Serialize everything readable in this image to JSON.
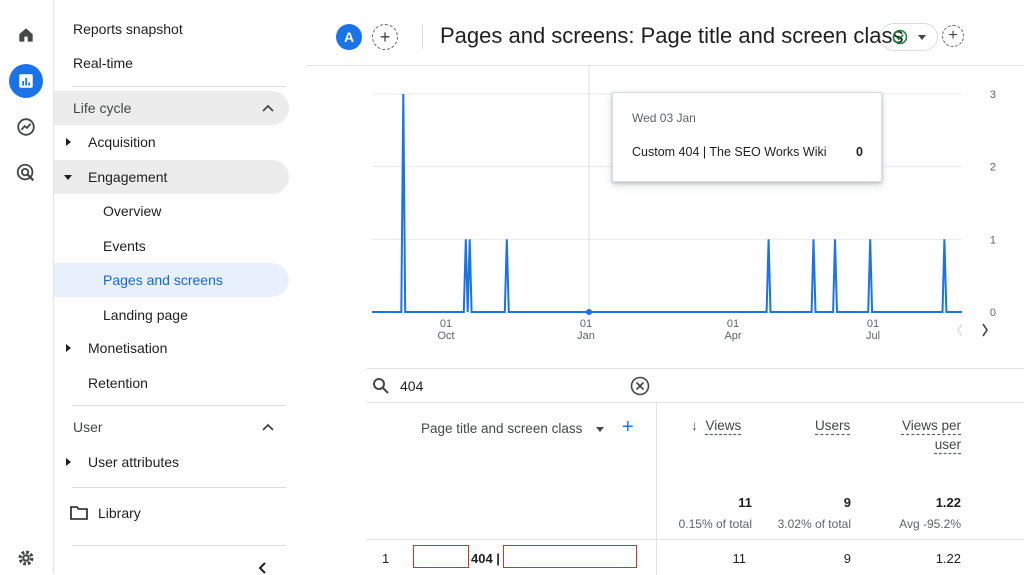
{
  "rail": {
    "icons": [
      "home-icon",
      "reports-icon",
      "explore-icon",
      "advertising-icon",
      "settings-icon"
    ]
  },
  "nav": {
    "reports_snapshot": "Reports snapshot",
    "realtime": "Real-time",
    "lifecycle": "Life cycle",
    "acquisition": "Acquisition",
    "engagement": "Engagement",
    "overview": "Overview",
    "events": "Events",
    "pages_and_screens": "Pages and screens",
    "landing_page": "Landing page",
    "monetisation": "Monetisation",
    "retention": "Retention",
    "user": "User",
    "user_attributes": "User attributes",
    "library": "Library"
  },
  "header": {
    "avatar_letter": "A",
    "title": "Pages and screens: Page title and screen class"
  },
  "chart_data": {
    "type": "line",
    "x_tick_labels": [
      {
        "day": "01",
        "month": "Oct"
      },
      {
        "day": "01",
        "month": "Jan"
      },
      {
        "day": "01",
        "month": "Apr"
      },
      {
        "day": "01",
        "month": "Jul"
      }
    ],
    "y_ticks": [
      0,
      1,
      2,
      3
    ],
    "ylim": [
      0,
      3
    ],
    "series_values": [
      0,
      0,
      0,
      0,
      0,
      0,
      0,
      0,
      0,
      0,
      0,
      0,
      0,
      0,
      0,
      0,
      3,
      0,
      0,
      0,
      0,
      0,
      0,
      0,
      0,
      0,
      0,
      0,
      0,
      0,
      0,
      0,
      0,
      0,
      0,
      0,
      0,
      0,
      0,
      0,
      0,
      0,
      0,
      0,
      0,
      0,
      0,
      0,
      1,
      0,
      1,
      0,
      0,
      0,
      0,
      0,
      0,
      0,
      0,
      0,
      0,
      0,
      0,
      0,
      0,
      0,
      0,
      0,
      0,
      1,
      0,
      0,
      0,
      0,
      0,
      0,
      0,
      0,
      0,
      0,
      0,
      0,
      0,
      0,
      0,
      0,
      0,
      0,
      0,
      0,
      0,
      0,
      0,
      0,
      0,
      0,
      0,
      0,
      0,
      0,
      0,
      0,
      0,
      0,
      0,
      0,
      0,
      0,
      0,
      0,
      0,
      0,
      0,
      0,
      0,
      0,
      0,
      0,
      0,
      0,
      0,
      0,
      0,
      0,
      0,
      0,
      0,
      0,
      0,
      0,
      0,
      0,
      0,
      0,
      0,
      0,
      0,
      0,
      0,
      0,
      0,
      0,
      0,
      0,
      0,
      0,
      0,
      0,
      0,
      0,
      0,
      0,
      0,
      0,
      0,
      0,
      0,
      0,
      0,
      0,
      0,
      0,
      0,
      0,
      0,
      0,
      0,
      0,
      0,
      0,
      0,
      0,
      0,
      0,
      0,
      0,
      0,
      0,
      0,
      0,
      0,
      0,
      0,
      0,
      0,
      0,
      0,
      0,
      0,
      0,
      0,
      0,
      0,
      0,
      0,
      0,
      0,
      0,
      0,
      0,
      0,
      0,
      0,
      1,
      0,
      0,
      0,
      0,
      0,
      0,
      0,
      0,
      0,
      0,
      0,
      0,
      0,
      0,
      0,
      0,
      0,
      0,
      0,
      0,
      0,
      0,
      1,
      0,
      0,
      0,
      0,
      0,
      0,
      0,
      0,
      0,
      0,
      1,
      0,
      0,
      0,
      0,
      0,
      0,
      0,
      0,
      0,
      0,
      0,
      0,
      0,
      0,
      0,
      0,
      0,
      1,
      0,
      0,
      0,
      0,
      0,
      0,
      0,
      0,
      0,
      0,
      0,
      0,
      0,
      0,
      0,
      0,
      0,
      0,
      0,
      0,
      0,
      0,
      0,
      0,
      0,
      0,
      0,
      0,
      0,
      0,
      0,
      0,
      0,
      0,
      0,
      0,
      0,
      1,
      0,
      0,
      0,
      0,
      0,
      0,
      0,
      0,
      0
    ],
    "tooltip": {
      "date": "Wed 03 Jan",
      "label": "Custom 404 | The SEO Works Wiki",
      "value": "0"
    },
    "line_color": "#1a73e8"
  },
  "search": {
    "value": "404"
  },
  "table": {
    "dimension_header": "Page title and screen class",
    "columns": [
      {
        "label": "Views",
        "sort": "↓"
      },
      {
        "label": "Users"
      },
      {
        "label_line1": "Views per",
        "label_line2": "user"
      }
    ],
    "totals": {
      "views": "11",
      "views_sub": "0.15% of total",
      "users": "9",
      "users_sub": "3.02% of total",
      "vpu": "1.22",
      "vpu_sub": "Avg -95.2%"
    },
    "rows": [
      {
        "index": "1",
        "title_visible": "404 |",
        "views": "11",
        "users": "9",
        "vpu": "1.22"
      }
    ]
  }
}
